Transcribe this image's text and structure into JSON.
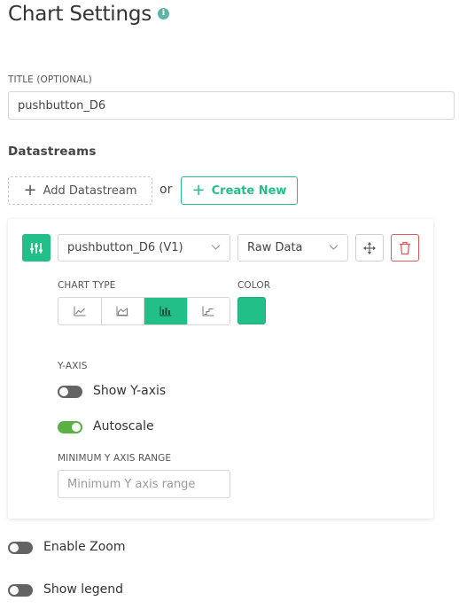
{
  "header": {
    "title": "Chart Settings",
    "info_icon": "i"
  },
  "title_field": {
    "label": "TITLE (OPTIONAL)",
    "value": "pushbutton_D6"
  },
  "datastreams": {
    "section_title": "Datastreams",
    "add_label": "Add Datastream",
    "or_text": "or",
    "create_label": "Create New",
    "item": {
      "datastream_value": "pushbutton_D6 (V1)",
      "aggregation_value": "Raw Data",
      "chart_type_label": "CHART TYPE",
      "chart_types": [
        "line",
        "area",
        "bar",
        "step"
      ],
      "chart_type_selected": "bar",
      "color_label": "COLOR",
      "color_value": "#23bf88",
      "y_axis_label": "Y-AXIS",
      "show_y_axis": {
        "label": "Show Y-axis",
        "on": false
      },
      "autoscale": {
        "label": "Autoscale",
        "on": true
      },
      "min_range_label": "MINIMUM Y AXIS RANGE",
      "min_range_placeholder": "Minimum Y axis range"
    }
  },
  "options": {
    "enable_zoom": {
      "label": "Enable Zoom",
      "on": false
    },
    "show_legend": {
      "label": "Show legend",
      "on": false
    }
  },
  "colors": {
    "accent": "#23bf88",
    "toggle_on": "#5ab044",
    "toggle_off": "#636363",
    "danger": "#e0595e"
  }
}
